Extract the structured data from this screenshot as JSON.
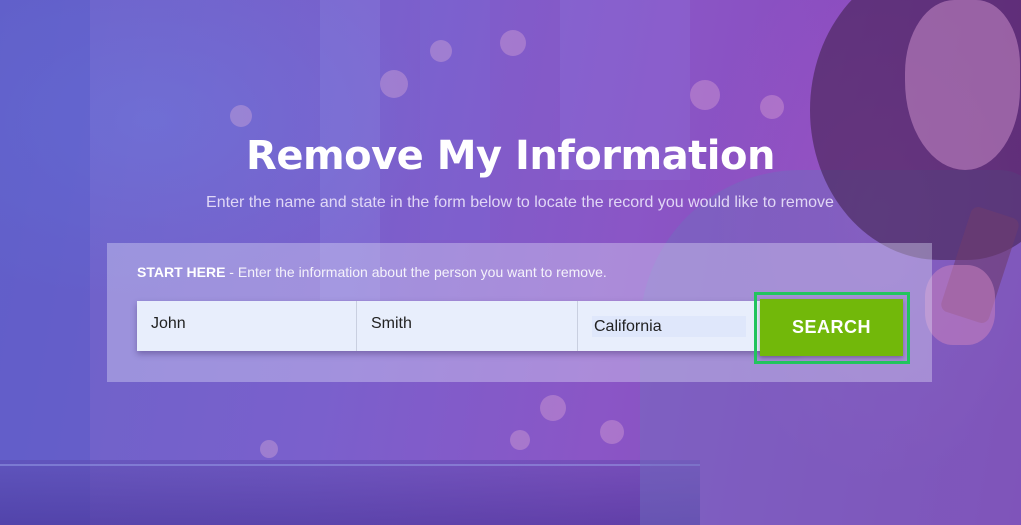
{
  "hero": {
    "title": "Remove My Information",
    "subtitle": "Enter the name and state in the form below to locate the record you would like to remove"
  },
  "form": {
    "instruction_bold": "START HERE",
    "instruction_rest": " - Enter the information about the person you want to remove.",
    "first_name": "John",
    "last_name": "Smith",
    "state": "California",
    "search_label": "SEARCH"
  },
  "colors": {
    "button": "#72b80a",
    "button_outline": "#22c55e",
    "background": "#7a60cc"
  }
}
